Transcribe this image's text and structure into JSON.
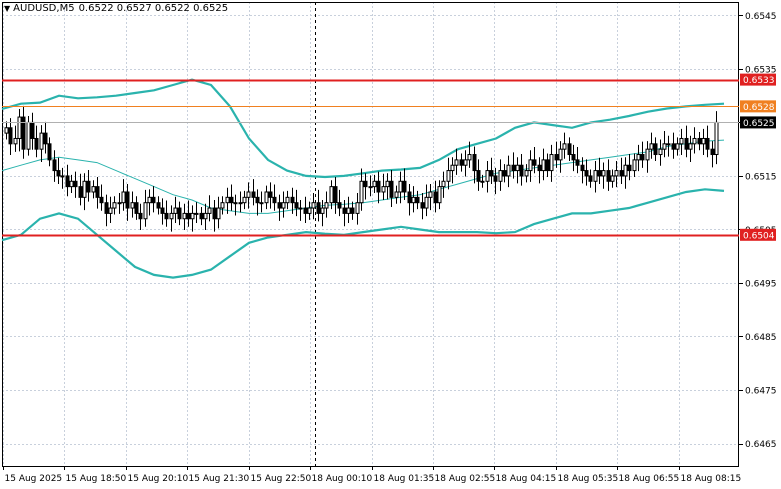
{
  "header": {
    "symbol": "AUDUSD,M5",
    "ohlc": "0.6522 0.6527 0.6522 0.6525"
  },
  "colors": {
    "grid": "#c8d0dc",
    "candle": "#000000",
    "bollinger": "#2ab3ad",
    "resistance": "#e02020",
    "orange": "#f08020",
    "current": "#000000"
  },
  "chart_data": {
    "type": "candlestick",
    "title": "",
    "ylim": [
      0.64608,
      0.65475
    ],
    "y_ticks": [
      "0.6545",
      "0.6535",
      "0.6525",
      "0.6515",
      "0.6505",
      "0.6495",
      "0.6485",
      "0.6475",
      "0.6465"
    ],
    "x_ticks": [
      "15 Aug 2025",
      "15 Aug 18:50",
      "15 Aug 20:10",
      "15 Aug 21:30",
      "15 Aug 22:50",
      "18 Aug 00:10",
      "18 Aug 01:35",
      "18 Aug 02:55",
      "18 Aug 04:15",
      "18 Aug 05:35",
      "18 Aug 06:55",
      "18 Aug 08:15"
    ],
    "levels": [
      {
        "label": "0.6533",
        "value": 0.6533,
        "kind": "resistance"
      },
      {
        "label": "0.6528",
        "value": 0.6528,
        "kind": "orange"
      },
      {
        "label": "0.6525",
        "value": 0.6525,
        "kind": "current"
      },
      {
        "label": "0.6504",
        "value": 0.6504,
        "kind": "support"
      }
    ],
    "bollinger": {
      "upper": [
        0.65275,
        0.65285,
        0.65287,
        0.653,
        0.65295,
        0.65297,
        0.653,
        0.65305,
        0.6531,
        0.6532,
        0.6533,
        0.6532,
        0.6528,
        0.6522,
        0.6518,
        0.6516,
        0.6515,
        0.65148,
        0.6515,
        0.65155,
        0.6516,
        0.65162,
        0.65165,
        0.6518,
        0.652,
        0.6521,
        0.6522,
        0.6524,
        0.6525,
        0.65245,
        0.6524,
        0.6525,
        0.65255,
        0.65262,
        0.6527,
        0.65276,
        0.6528,
        0.65283,
        0.65285
      ],
      "middle": [
        0.6516,
        0.6517,
        0.6518,
        0.65185,
        0.6518,
        0.65175,
        0.6516,
        0.65145,
        0.6513,
        0.65115,
        0.65105,
        0.6509,
        0.65085,
        0.6508,
        0.6508,
        0.65085,
        0.6509,
        0.65095,
        0.65097,
        0.651,
        0.65105,
        0.6511,
        0.65115,
        0.65125,
        0.65135,
        0.65145,
        0.65155,
        0.6516,
        0.65165,
        0.6517,
        0.65175,
        0.6518,
        0.65185,
        0.6519,
        0.65195,
        0.65205,
        0.6521,
        0.65215,
        0.65217
      ],
      "lower": [
        0.6503,
        0.6504,
        0.6507,
        0.6508,
        0.6507,
        0.6504,
        0.6501,
        0.6498,
        0.64965,
        0.6496,
        0.64965,
        0.64975,
        0.65,
        0.65025,
        0.65035,
        0.6504,
        0.65045,
        0.65042,
        0.6504,
        0.65045,
        0.6505,
        0.65055,
        0.6505,
        0.65045,
        0.65045,
        0.65045,
        0.65043,
        0.65045,
        0.6506,
        0.6507,
        0.6508,
        0.6508,
        0.65085,
        0.6509,
        0.651,
        0.6511,
        0.6512,
        0.65125,
        0.65122
      ]
    },
    "closes": [
      0.6524,
      0.6521,
      0.6522,
      0.6526,
      0.652,
      0.6525,
      0.6522,
      0.652,
      0.6523,
      0.6521,
      0.6518,
      0.6516,
      0.6515,
      0.6515,
      0.6513,
      0.6514,
      0.6513,
      0.6511,
      0.6514,
      0.6512,
      0.6513,
      0.6511,
      0.651,
      0.6508,
      0.6509,
      0.651,
      0.651,
      0.6512,
      0.6509,
      0.651,
      0.6508,
      0.6507,
      0.651,
      0.6511,
      0.651,
      0.6509,
      0.6508,
      0.6507,
      0.6508,
      0.6509,
      0.6507,
      0.6508,
      0.6507,
      0.6508,
      0.6508,
      0.6507,
      0.6508,
      0.6509,
      0.6507,
      0.6509,
      0.651,
      0.6511,
      0.651,
      0.651,
      0.651,
      0.6511,
      0.6512,
      0.6511,
      0.651,
      0.651,
      0.6512,
      0.6511,
      0.651,
      0.6509,
      0.651,
      0.6511,
      0.651,
      0.6509,
      0.6509,
      0.6508,
      0.6509,
      0.651,
      0.6508,
      0.6509,
      0.651,
      0.6513,
      0.651,
      0.6509,
      0.6508,
      0.6509,
      0.6508,
      0.651,
      0.6514,
      0.6513,
      0.6513,
      0.6514,
      0.6512,
      0.6513,
      0.6514,
      0.6511,
      0.6512,
      0.6514,
      0.6512,
      0.651,
      0.6511,
      0.651,
      0.6509,
      0.6511,
      0.6512,
      0.651,
      0.6513,
      0.6514,
      0.6516,
      0.6517,
      0.6518,
      0.6517,
      0.6518,
      0.6519,
      0.6516,
      0.6514,
      0.6514,
      0.6516,
      0.6515,
      0.6514,
      0.6516,
      0.6515,
      0.6517,
      0.6516,
      0.6517,
      0.6515,
      0.6516,
      0.6518,
      0.6517,
      0.6516,
      0.6518,
      0.6516,
      0.6519,
      0.6518,
      0.652,
      0.6521,
      0.6519,
      0.6518,
      0.6517,
      0.6516,
      0.6515,
      0.6514,
      0.6516,
      0.6515,
      0.6516,
      0.6514,
      0.6515,
      0.6516,
      0.6515,
      0.6517,
      0.6516,
      0.6518,
      0.6519,
      0.6518,
      0.652,
      0.6521,
      0.6519,
      0.652,
      0.6521,
      0.6521,
      0.652,
      0.6521,
      0.6522,
      0.652,
      0.6521,
      0.6522,
      0.6521,
      0.6522,
      0.652,
      0.6519,
      0.6525
    ]
  }
}
